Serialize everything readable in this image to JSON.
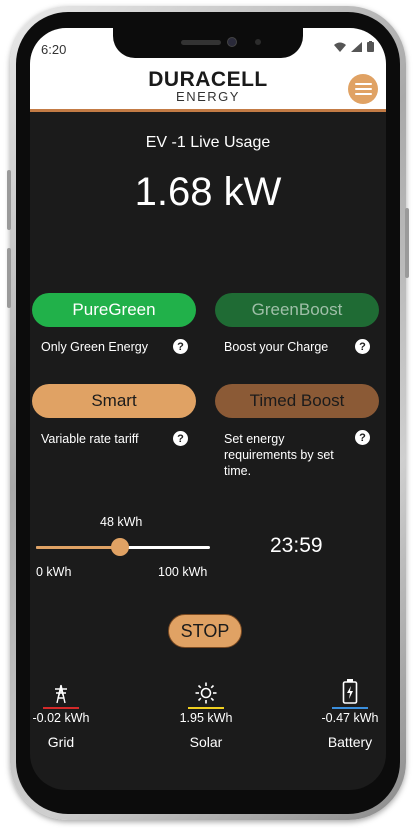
{
  "status_bar": {
    "time": "6:20"
  },
  "brand": {
    "name": "DURACELL",
    "sub": "ENERGY"
  },
  "live": {
    "title": "EV -1 Live Usage",
    "power": "1.68 kW"
  },
  "modes": [
    {
      "label": "PureGreen",
      "desc": "Only Green Energy",
      "color": "#21b14a"
    },
    {
      "label": "GreenBoost",
      "desc": "Boost your Charge",
      "color": "#1f6b34"
    },
    {
      "label": "Smart",
      "desc": "Variable rate tariff",
      "color": "#e0a264"
    },
    {
      "label": "Timed Boost",
      "desc": "Set energy requirements by set time.",
      "color": "#8b5a36"
    }
  ],
  "slider": {
    "value_label": "48 kWh",
    "min_label": "0 kWh",
    "max_label": "100 kWh",
    "value": 48,
    "max": 100
  },
  "timer": "23:59",
  "stop_label": "STOP",
  "energy": [
    {
      "name": "Grid",
      "value": "-0.02 kWh",
      "icon": "transmission-tower-icon",
      "color": "#d42a2a"
    },
    {
      "name": "Solar",
      "value": "1.95 kWh",
      "icon": "sun-icon",
      "color": "#f0d020"
    },
    {
      "name": "Battery",
      "value": "-0.47 kWh",
      "icon": "battery-charging-icon",
      "color": "#3a8edc"
    }
  ],
  "help_glyph": "?"
}
